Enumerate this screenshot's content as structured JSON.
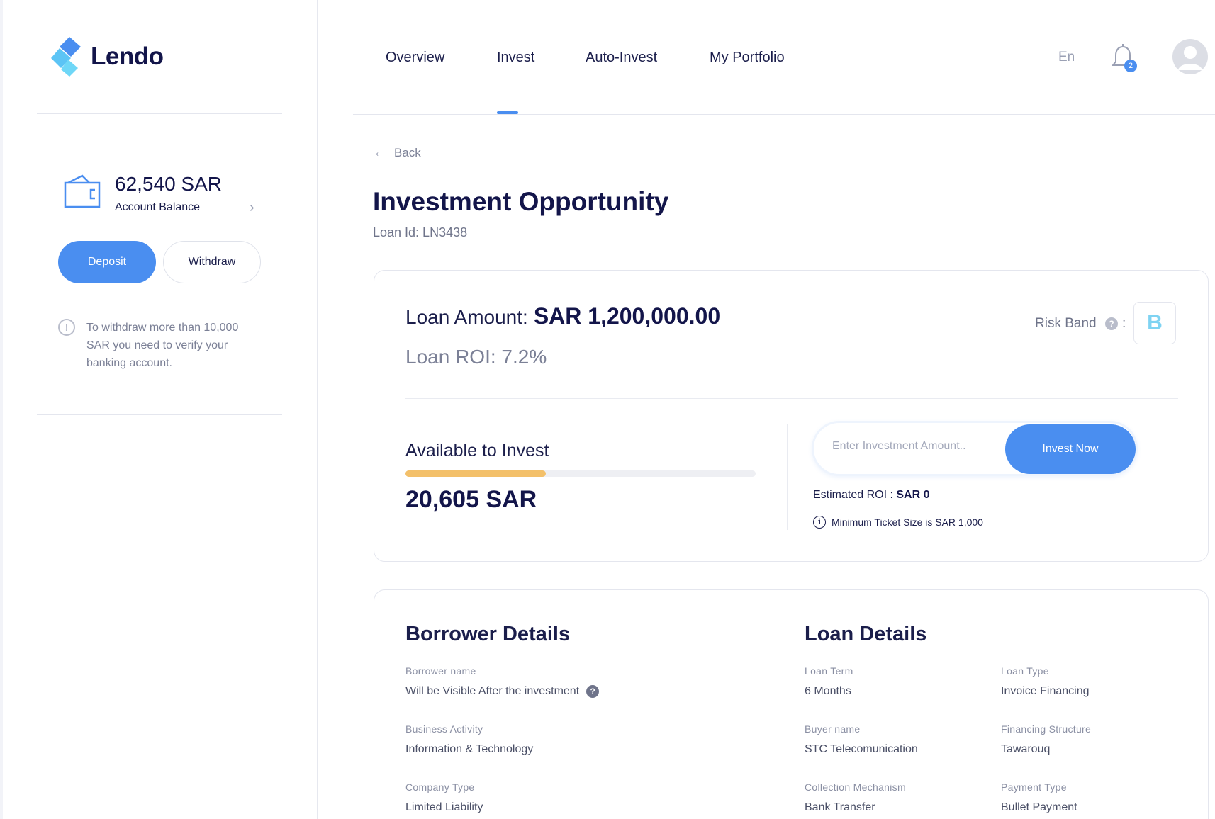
{
  "brand": {
    "name": "Lendo",
    "primary_color": "#4a8ef0",
    "dark_color": "#13154a",
    "progress_color": "#f3c06a"
  },
  "sidebar": {
    "balance_amount": "62,540 SAR",
    "balance_label": "Account Balance",
    "deposit_label": "Deposit",
    "withdraw_label": "Withdraw",
    "notice": "To withdraw more than 10,000 SAR you need to verify your banking account."
  },
  "nav": {
    "items": [
      {
        "label": "Overview"
      },
      {
        "label": "Invest",
        "active": true
      },
      {
        "label": "Auto-Invest"
      },
      {
        "label": "My Portfolio"
      }
    ],
    "language": "En",
    "notification_count": "2"
  },
  "page": {
    "back_label": "Back",
    "title": "Investment Opportunity",
    "loan_id": "Loan Id: LN3438"
  },
  "summary": {
    "loan_amount_label": "Loan Amount:",
    "loan_amount_value": "SAR 1,200,000.00",
    "loan_roi": "Loan ROI: 7.2%",
    "risk_band_label": "Risk Band",
    "risk_band_value": "B",
    "available_label": "Available to Invest",
    "available_amount": "20,605 SAR",
    "available_progress": 0.4,
    "investment_placeholder": "Enter Investment Amount..",
    "invest_button": "Invest Now",
    "estimated_roi_label": "Estimated ROI :",
    "estimated_roi_value": "SAR 0",
    "min_ticket": "Minimum Ticket Size is SAR 1,000"
  },
  "borrower": {
    "title": "Borrower Details",
    "name_label": "Borrower name",
    "name_value": "Will be Visible After the investment",
    "activity_label": "Business Activity",
    "activity_value": "Information & Technology",
    "company_type_label": "Company Type",
    "company_type_value": "Limited Liability"
  },
  "loan": {
    "title": "Loan Details",
    "term_label": "Loan Term",
    "term_value": "6 Months",
    "type_label": "Loan Type",
    "type_value": "Invoice Financing",
    "buyer_label": "Buyer name",
    "buyer_value": "STC Telecomunication",
    "structure_label": "Financing Structure",
    "structure_value": "Tawarouq",
    "collection_label": "Collection Mechanism",
    "collection_value": "Bank Transfer",
    "payment_label": "Payment Type",
    "payment_value": "Bullet Payment"
  }
}
